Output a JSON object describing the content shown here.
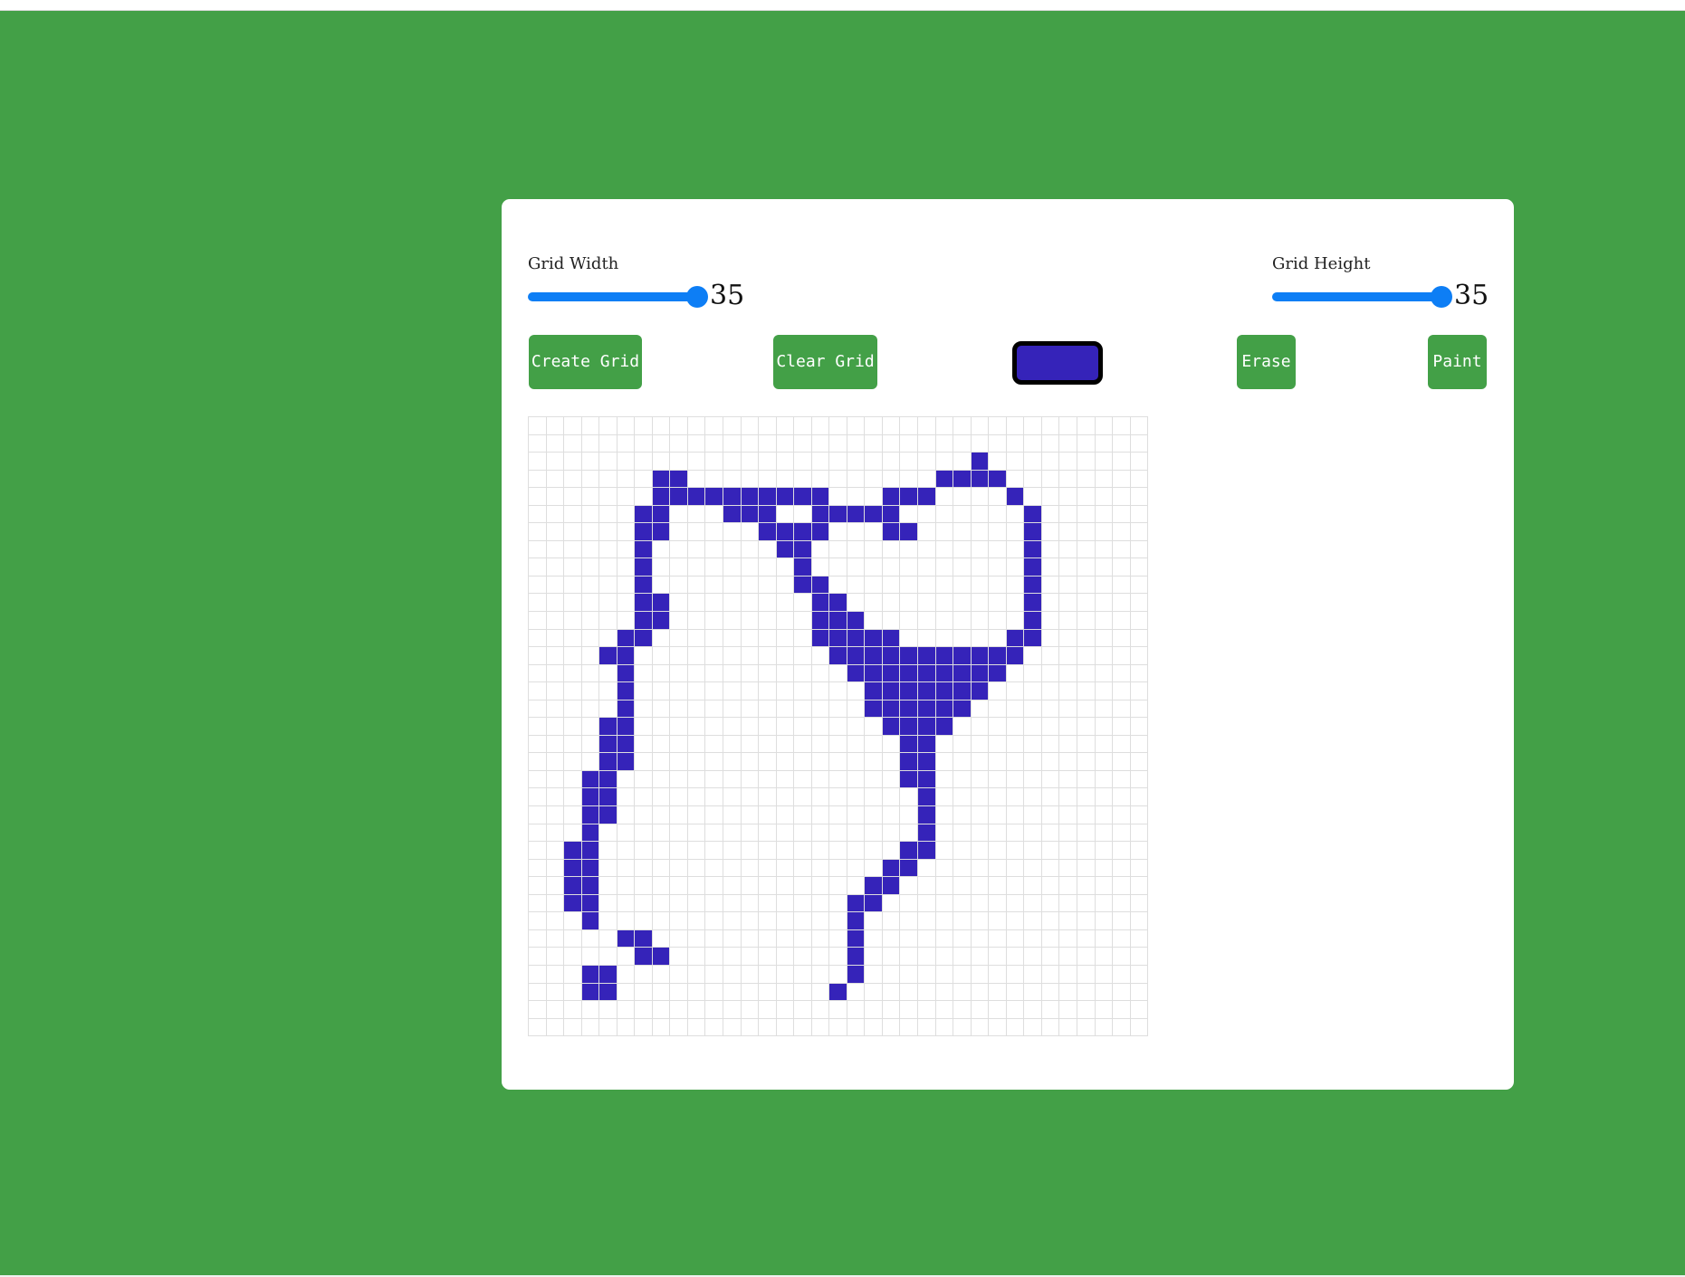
{
  "app": {
    "background_color": "#43a047",
    "accent_color": "#0d7ef5",
    "button_color": "#43a047"
  },
  "controls": {
    "grid_width": {
      "label": "Grid Width",
      "value": "35",
      "fraction": 1.0
    },
    "grid_height": {
      "label": "Grid Height",
      "value": "35",
      "fraction": 1.0
    }
  },
  "toolbar": {
    "create_grid_label": "Create Grid",
    "clear_grid_label": "Clear Grid",
    "selected_color": "#3523b9",
    "erase_label": "Erase",
    "paint_label": "Paint"
  },
  "grid": {
    "columns": 35,
    "rows": 35,
    "empty_color": "#ffffff",
    "line_color": "#dedede",
    "paint_color": "#3523b9",
    "painted": [
      [
        2,
        25
      ],
      [
        3,
        7
      ],
      [
        3,
        8
      ],
      [
        3,
        23
      ],
      [
        3,
        24
      ],
      [
        3,
        25
      ],
      [
        3,
        26
      ],
      [
        4,
        7
      ],
      [
        4,
        8
      ],
      [
        4,
        9
      ],
      [
        4,
        10
      ],
      [
        4,
        11
      ],
      [
        4,
        12
      ],
      [
        4,
        13
      ],
      [
        4,
        14
      ],
      [
        4,
        15
      ],
      [
        4,
        16
      ],
      [
        4,
        20
      ],
      [
        4,
        21
      ],
      [
        4,
        22
      ],
      [
        4,
        27
      ],
      [
        5,
        6
      ],
      [
        5,
        7
      ],
      [
        5,
        11
      ],
      [
        5,
        12
      ],
      [
        5,
        13
      ],
      [
        5,
        16
      ],
      [
        5,
        17
      ],
      [
        5,
        18
      ],
      [
        5,
        19
      ],
      [
        5,
        20
      ],
      [
        5,
        28
      ],
      [
        6,
        6
      ],
      [
        6,
        7
      ],
      [
        6,
        13
      ],
      [
        6,
        14
      ],
      [
        6,
        15
      ],
      [
        6,
        16
      ],
      [
        6,
        20
      ],
      [
        6,
        21
      ],
      [
        6,
        28
      ],
      [
        7,
        6
      ],
      [
        7,
        14
      ],
      [
        7,
        15
      ],
      [
        7,
        28
      ],
      [
        8,
        6
      ],
      [
        8,
        15
      ],
      [
        8,
        28
      ],
      [
        9,
        6
      ],
      [
        9,
        15
      ],
      [
        9,
        16
      ],
      [
        9,
        28
      ],
      [
        10,
        6
      ],
      [
        10,
        7
      ],
      [
        10,
        16
      ],
      [
        10,
        17
      ],
      [
        10,
        28
      ],
      [
        11,
        6
      ],
      [
        11,
        7
      ],
      [
        11,
        16
      ],
      [
        11,
        17
      ],
      [
        11,
        18
      ],
      [
        11,
        28
      ],
      [
        12,
        5
      ],
      [
        12,
        6
      ],
      [
        12,
        16
      ],
      [
        12,
        17
      ],
      [
        12,
        18
      ],
      [
        12,
        19
      ],
      [
        12,
        20
      ],
      [
        12,
        27
      ],
      [
        12,
        28
      ],
      [
        13,
        4
      ],
      [
        13,
        5
      ],
      [
        13,
        17
      ],
      [
        13,
        18
      ],
      [
        13,
        19
      ],
      [
        13,
        20
      ],
      [
        13,
        21
      ],
      [
        13,
        22
      ],
      [
        13,
        23
      ],
      [
        13,
        24
      ],
      [
        13,
        25
      ],
      [
        13,
        26
      ],
      [
        13,
        27
      ],
      [
        14,
        5
      ],
      [
        14,
        18
      ],
      [
        14,
        19
      ],
      [
        14,
        20
      ],
      [
        14,
        21
      ],
      [
        14,
        22
      ],
      [
        14,
        23
      ],
      [
        14,
        24
      ],
      [
        14,
        25
      ],
      [
        14,
        26
      ],
      [
        15,
        5
      ],
      [
        15,
        19
      ],
      [
        15,
        20
      ],
      [
        15,
        21
      ],
      [
        15,
        22
      ],
      [
        15,
        23
      ],
      [
        15,
        24
      ],
      [
        15,
        25
      ],
      [
        16,
        5
      ],
      [
        16,
        19
      ],
      [
        16,
        20
      ],
      [
        16,
        21
      ],
      [
        16,
        22
      ],
      [
        16,
        23
      ],
      [
        16,
        24
      ],
      [
        17,
        4
      ],
      [
        17,
        5
      ],
      [
        17,
        20
      ],
      [
        17,
        21
      ],
      [
        17,
        22
      ],
      [
        17,
        23
      ],
      [
        18,
        4
      ],
      [
        18,
        5
      ],
      [
        18,
        21
      ],
      [
        18,
        22
      ],
      [
        19,
        4
      ],
      [
        19,
        5
      ],
      [
        19,
        21
      ],
      [
        19,
        22
      ],
      [
        20,
        3
      ],
      [
        20,
        4
      ],
      [
        20,
        21
      ],
      [
        20,
        22
      ],
      [
        21,
        3
      ],
      [
        21,
        4
      ],
      [
        21,
        22
      ],
      [
        22,
        3
      ],
      [
        22,
        4
      ],
      [
        22,
        22
      ],
      [
        23,
        3
      ],
      [
        23,
        22
      ],
      [
        24,
        2
      ],
      [
        24,
        3
      ],
      [
        24,
        21
      ],
      [
        24,
        22
      ],
      [
        25,
        2
      ],
      [
        25,
        3
      ],
      [
        25,
        20
      ],
      [
        25,
        21
      ],
      [
        26,
        2
      ],
      [
        26,
        3
      ],
      [
        26,
        19
      ],
      [
        26,
        20
      ],
      [
        27,
        2
      ],
      [
        27,
        3
      ],
      [
        27,
        18
      ],
      [
        27,
        19
      ],
      [
        28,
        3
      ],
      [
        28,
        18
      ],
      [
        29,
        5
      ],
      [
        29,
        6
      ],
      [
        29,
        18
      ],
      [
        30,
        6
      ],
      [
        30,
        7
      ],
      [
        30,
        18
      ],
      [
        31,
        3
      ],
      [
        31,
        4
      ],
      [
        31,
        18
      ],
      [
        32,
        3
      ],
      [
        32,
        4
      ],
      [
        32,
        17
      ]
    ]
  }
}
